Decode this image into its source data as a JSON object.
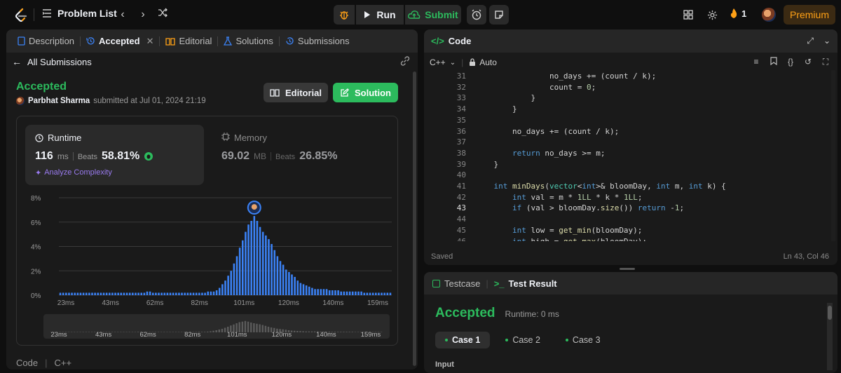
{
  "topbar": {
    "title": "Problem List",
    "run_label": "Run",
    "submit_label": "Submit",
    "streak_count": "1",
    "premium_label": "Premium"
  },
  "left_panel": {
    "tabs": [
      {
        "label": "Description"
      },
      {
        "label": "Accepted"
      },
      {
        "label": "Editorial"
      },
      {
        "label": "Solutions"
      },
      {
        "label": "Submissions"
      }
    ],
    "back_label": "All Submissions",
    "status": "Accepted",
    "user_name": "Parbhat Sharma",
    "submitted_text": "submitted at Jul 01, 2024 21:19",
    "editorial_button": "Editorial",
    "solution_button": "Solution",
    "runtime": {
      "title": "Runtime",
      "value": "116",
      "unit": "ms",
      "beats_label": "Beats",
      "beats_value": "58.81%",
      "analyze_label": "Analyze Complexity"
    },
    "memory": {
      "title": "Memory",
      "value": "69.02",
      "unit": "MB",
      "beats_label": "Beats",
      "beats_value": "26.85%"
    },
    "footer_code": "Code",
    "footer_lang": "C++"
  },
  "chart_data": {
    "type": "bar",
    "y_ticks": [
      "8%",
      "6%",
      "4%",
      "2%",
      "0%"
    ],
    "ylim": [
      0,
      8
    ],
    "x_ticks": [
      "23ms",
      "43ms",
      "62ms",
      "82ms",
      "101ms",
      "120ms",
      "140ms",
      "159ms"
    ],
    "values": [
      0.2,
      0.2,
      0.2,
      0.2,
      0.2,
      0.2,
      0.2,
      0.2,
      0.2,
      0.2,
      0.2,
      0.2,
      0.2,
      0.2,
      0.2,
      0.2,
      0.2,
      0.2,
      0.2,
      0.2,
      0.2,
      0.2,
      0.2,
      0.2,
      0.2,
      0.2,
      0.2,
      0.2,
      0.2,
      0.2,
      0.3,
      0.3,
      0.2,
      0.2,
      0.2,
      0.2,
      0.2,
      0.2,
      0.2,
      0.2,
      0.2,
      0.2,
      0.2,
      0.2,
      0.2,
      0.2,
      0.2,
      0.2,
      0.2,
      0.2,
      0.2,
      0.3,
      0.3,
      0.3,
      0.4,
      0.6,
      0.9,
      1.2,
      1.6,
      2.0,
      2.6,
      3.2,
      3.9,
      4.5,
      5.2,
      5.8,
      6.1,
      6.5,
      6.1,
      5.6,
      5.2,
      4.9,
      4.6,
      4.2,
      3.7,
      3.2,
      2.8,
      2.5,
      2.1,
      1.9,
      1.7,
      1.5,
      1.2,
      1.0,
      0.9,
      0.8,
      0.7,
      0.6,
      0.5,
      0.5,
      0.5,
      0.5,
      0.5,
      0.4,
      0.4,
      0.4,
      0.4,
      0.3,
      0.3,
      0.3,
      0.3,
      0.3,
      0.3,
      0.3,
      0.3,
      0.2,
      0.2,
      0.2,
      0.2,
      0.2,
      0.2,
      0.2,
      0.2,
      0.2,
      0.2
    ],
    "highlight_index": 67,
    "bar_color": "#3b82f6"
  },
  "code_panel": {
    "title": "Code",
    "language": "C++",
    "mode": "Auto",
    "saved_label": "Saved",
    "cursor_pos": "Ln 43, Col 46",
    "lines": [
      {
        "num": "31",
        "code": "                no_days += (count / k);"
      },
      {
        "num": "32",
        "code": "                count = 0;"
      },
      {
        "num": "33",
        "code": "            }"
      },
      {
        "num": "34",
        "code": "        }"
      },
      {
        "num": "35",
        "code": ""
      },
      {
        "num": "36",
        "code": "        no_days += (count / k);"
      },
      {
        "num": "37",
        "code": ""
      },
      {
        "num": "38",
        "code": "        return no_days >= m;"
      },
      {
        "num": "39",
        "code": "    }"
      },
      {
        "num": "40",
        "code": ""
      },
      {
        "num": "41",
        "code": "    int minDays(vector<int>& bloomDay, int m, int k) {"
      },
      {
        "num": "42",
        "code": "        int val = m * 1LL * k * 1LL;"
      },
      {
        "num": "43",
        "code": "        if (val > bloomDay.size()) return -1;"
      },
      {
        "num": "44",
        "code": ""
      },
      {
        "num": "45",
        "code": "        int low = get_min(bloomDay);"
      },
      {
        "num": "46",
        "code": "        int high = get_max(bloomDay);"
      }
    ]
  },
  "test_panel": {
    "testcase_tab": "Testcase",
    "result_tab": "Test Result",
    "status": "Accepted",
    "runtime_text": "Runtime: 0 ms",
    "cases": [
      "Case 1",
      "Case 2",
      "Case 3"
    ],
    "input_label": "Input"
  }
}
